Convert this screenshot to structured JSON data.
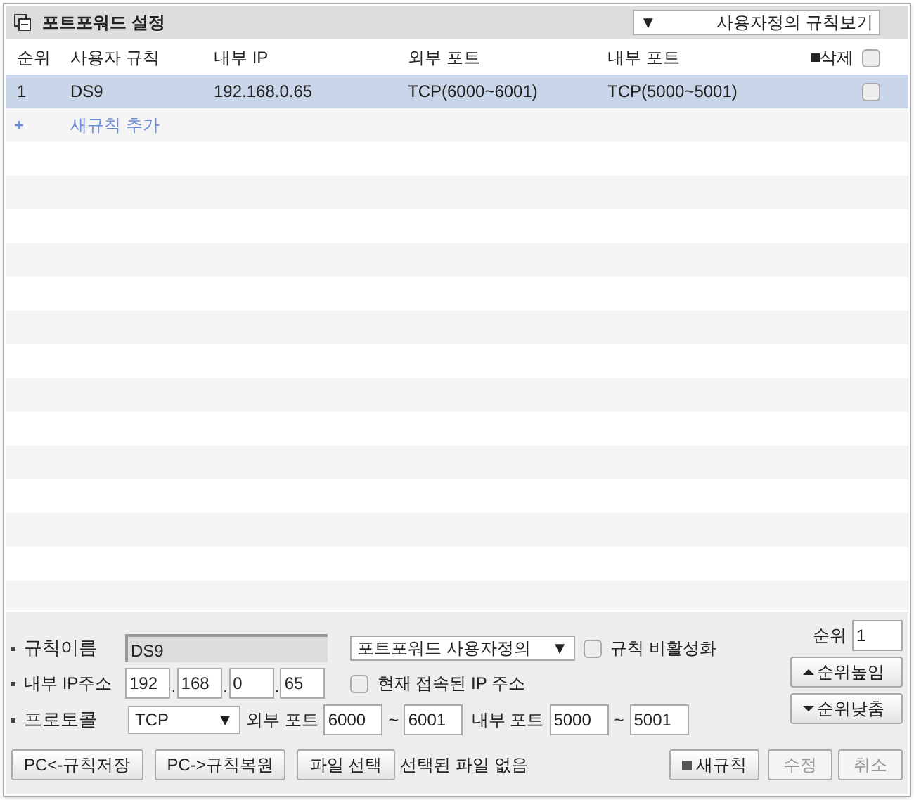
{
  "header": {
    "title": "포트포워드 설정",
    "view_select": "사용자정의 규칙보기",
    "view_arrow": "▼"
  },
  "table": {
    "columns": [
      "순위",
      "사용자 규칙",
      "내부 IP",
      "외부 포트",
      "내부 포트",
      "삭제"
    ],
    "select_all_checked": false,
    "rows": [
      {
        "rank": "1",
        "name": "DS9",
        "ip": "192.168.0.65",
        "external": "TCP(6000~6001)",
        "internal": "TCP(5000~5001)",
        "selected": true,
        "checked": false
      }
    ],
    "add_rule": {
      "icon": "+",
      "label": "새규칙 추가"
    }
  },
  "form": {
    "name_label": "규칙이름",
    "name_value": "DS9",
    "type_select": "포트포워드 사용자정의",
    "disable_label": "규칙 비활성화",
    "disable_checked": false,
    "ip_label": "내부 IP주소",
    "ip_parts": [
      "192",
      "168",
      "0",
      "65"
    ],
    "current_ip_label": "현재 접속된 IP 주소",
    "current_ip_checked": false,
    "protocol_label": "프로토콜",
    "protocol": "TCP",
    "external_label": "외부 포트",
    "external_from": "6000",
    "external_to": "6001",
    "internal_label": "내부 포트",
    "internal_from": "5000",
    "internal_to": "5001",
    "tilde": "~",
    "dot": ".",
    "rank_label": "순위",
    "rank_value": "1",
    "rank_up": "순위높임",
    "rank_down": "순위낮춤"
  },
  "footer": {
    "save": "PC<-규칙저장",
    "restore": "PC->규칙복원",
    "file_button": "파일 선택",
    "file_status": "선택된 파일 없음",
    "new_rule": "새규칙",
    "edit": "수정",
    "edit_disabled": true,
    "cancel": "취소",
    "cancel_disabled": true
  }
}
